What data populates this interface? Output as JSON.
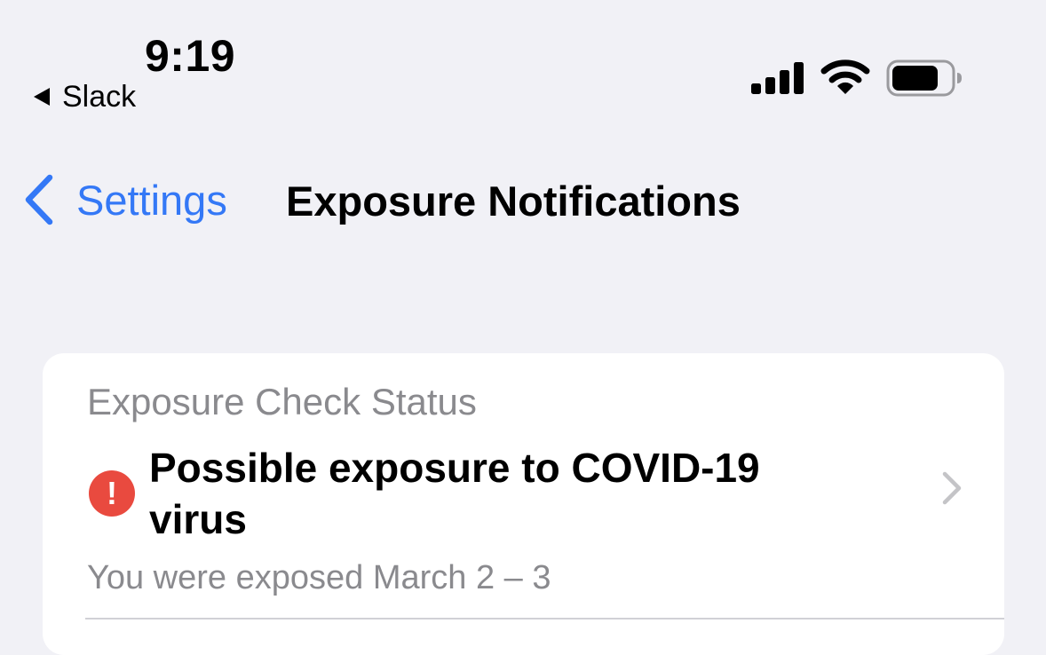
{
  "status_bar": {
    "time": "9:19",
    "back_app_label": "Slack",
    "signal": "cellular-signal-4-bars",
    "wifi": "wifi-full",
    "battery_level_fraction": 0.8
  },
  "nav": {
    "back_label": "Settings",
    "title": "Exposure Notifications"
  },
  "exposure_status": {
    "section_label": "Exposure Check Status",
    "title": "Possible exposure to COVID-19 virus",
    "detail": "You were exposed March 2 – 3",
    "alert_glyph": "!",
    "alert_color": "#e94a3f"
  },
  "colors": {
    "accent": "#3478f6",
    "background": "#f1f1f6",
    "secondary_text": "#8a8a8e"
  }
}
